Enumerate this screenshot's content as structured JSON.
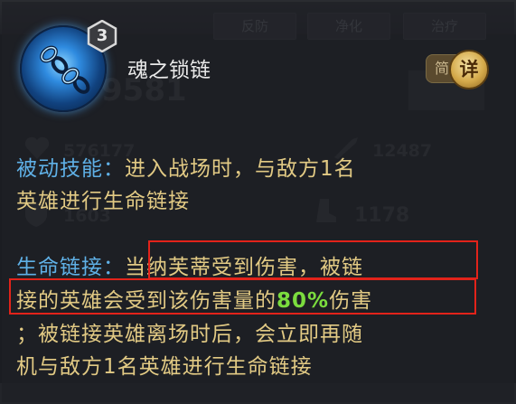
{
  "background": {
    "tabs": [
      "反防",
      "净化",
      "治疗"
    ],
    "stats": [
      "9581",
      "576177",
      "12487",
      "1603",
      "1178"
    ]
  },
  "skill": {
    "level": "3",
    "name": "魂之锁链",
    "toggle_simple": "简",
    "toggle_detail": "详"
  },
  "description": {
    "line1_label": "被动技能：",
    "line1_text": "进入战场时，与敌方1名",
    "line2": "英雄进行生命链接",
    "line3_label": "生命链接：",
    "line3_text": "当纳芙蒂受到伤害，被链",
    "line4_a": "接的英雄会受到该伤害量的",
    "line4_pct": "80%",
    "line4_b": "伤害",
    "line5": "；被链接英雄离场时后，会立即再随",
    "line6": "机与敌方1名英雄进行生命链接"
  },
  "colors": {
    "label": "#5fb0e6",
    "text": "#e2ca84",
    "percent": "#7bdc3e",
    "highlight_box": "#e2231a"
  }
}
